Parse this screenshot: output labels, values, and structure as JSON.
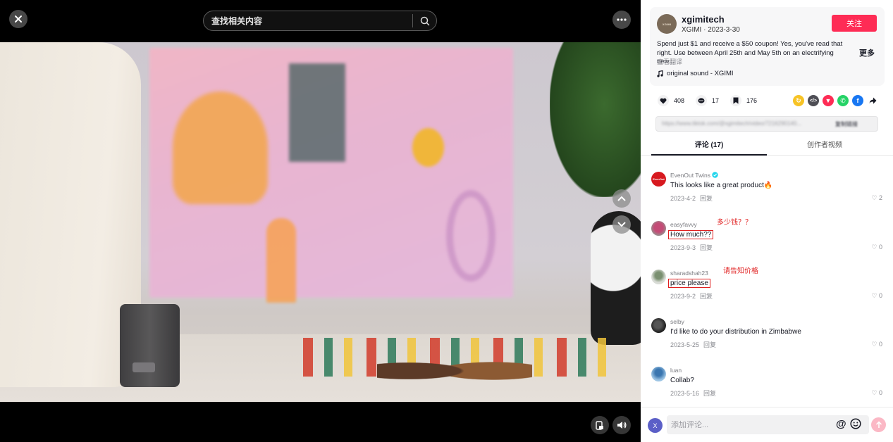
{
  "search": {
    "placeholder": "查找相关内容"
  },
  "author": {
    "avatar_text": "XGIMI",
    "name": "xgimitech",
    "subtitle": "XGIMI · 2023-3-30",
    "follow_label": "关注",
    "description": "Spend just $1 and receive a $50 coupon! Yes, you've read that right. Use between April 25th and May 5th on an electrifying new...",
    "more_label": "更多",
    "translate_label": "查看翻译",
    "sound": "original sound - XGIMI"
  },
  "stats": {
    "likes": "408",
    "comments": "17",
    "saves": "176"
  },
  "share_icons": [
    {
      "name": "repost-icon",
      "color": "#f7c325"
    },
    {
      "name": "embed-icon",
      "color": "#4e4e55"
    },
    {
      "name": "send-to-friend-icon",
      "color": "#fe2c55"
    },
    {
      "name": "whatsapp-icon",
      "color": "#25d366"
    },
    {
      "name": "facebook-icon",
      "color": "#1877f2"
    },
    {
      "name": "share-arrow-icon",
      "color": "#161823"
    }
  ],
  "link": {
    "url": "https://www.tiktok.com/@xgimitech/video/7216290140...",
    "copy_label": "复制链接"
  },
  "tabs": {
    "comments": "评论 (17)",
    "creator_videos": "创作者视频"
  },
  "comments": [
    {
      "user": "EvenOut Twins",
      "verified": true,
      "text": "This looks like a great product🔥",
      "date": "2023-4-2",
      "reply": "回复",
      "likes": "2",
      "annotation": ""
    },
    {
      "user": "easyfavvy",
      "verified": false,
      "text": "How much??",
      "date": "2023-9-3",
      "reply": "回复",
      "likes": "0",
      "annotation": "多少钱？？"
    },
    {
      "user": "sharadshah23",
      "verified": false,
      "text": "price please",
      "date": "2023-9-2",
      "reply": "回复",
      "likes": "0",
      "annotation": "请告知价格"
    },
    {
      "user": "selby",
      "verified": false,
      "text": "I'd like to do your distribution in Zimbabwe",
      "date": "2023-5-25",
      "reply": "回复",
      "likes": "0",
      "annotation": ""
    },
    {
      "user": "luan",
      "verified": false,
      "text": "Collab?",
      "date": "2023-5-16",
      "reply": "回复",
      "likes": "0",
      "annotation": ""
    }
  ],
  "composer": {
    "avatar_letter": "X",
    "placeholder": "添加评论...",
    "at_symbol": "@"
  },
  "colors": {
    "accent": "#fe2c55",
    "annotation_red": "#e02020",
    "send_disabled": "#fbb8c5"
  }
}
